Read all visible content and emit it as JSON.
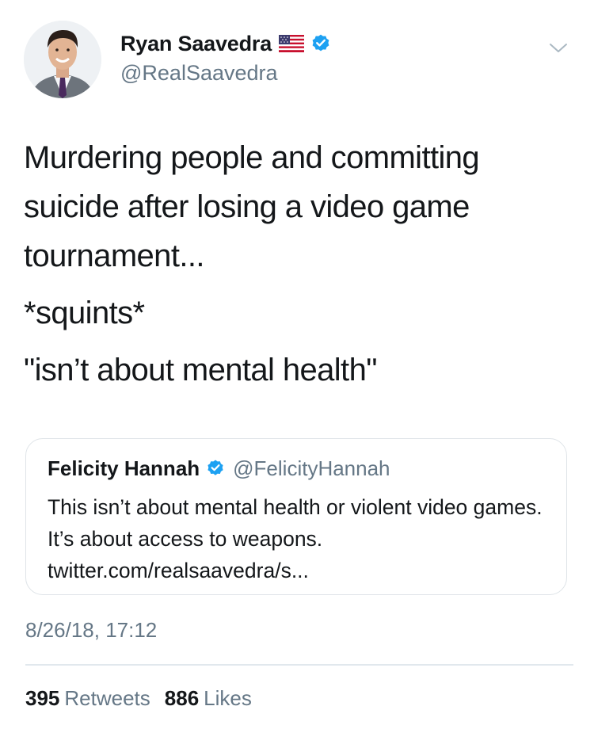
{
  "author": {
    "display_name": "Ryan Saavedra",
    "handle": "@RealSaavedra",
    "flag_icon": "us-flag-icon",
    "verified": true
  },
  "tweet": {
    "paragraphs": [
      "Murdering people and committing suicide after losing a video game tournament...",
      "*squints*",
      "\"isn’t about mental health\""
    ],
    "timestamp": "8/26/18, 17:12"
  },
  "quoted_tweet": {
    "display_name": "Felicity Hannah",
    "handle": "@FelicityHannah",
    "verified": true,
    "text": "This isn’t about mental health or violent video games. It’s about access to weapons. twitter.com/realsaavedra/s..."
  },
  "stats": {
    "retweets_count": "395",
    "retweets_label": "Retweets",
    "likes_count": "886",
    "likes_label": "Likes"
  },
  "colors": {
    "verified_blue": "#1da1f2",
    "secondary_text": "#657786",
    "primary_text": "#14171a",
    "border": "#dfe4e8"
  }
}
